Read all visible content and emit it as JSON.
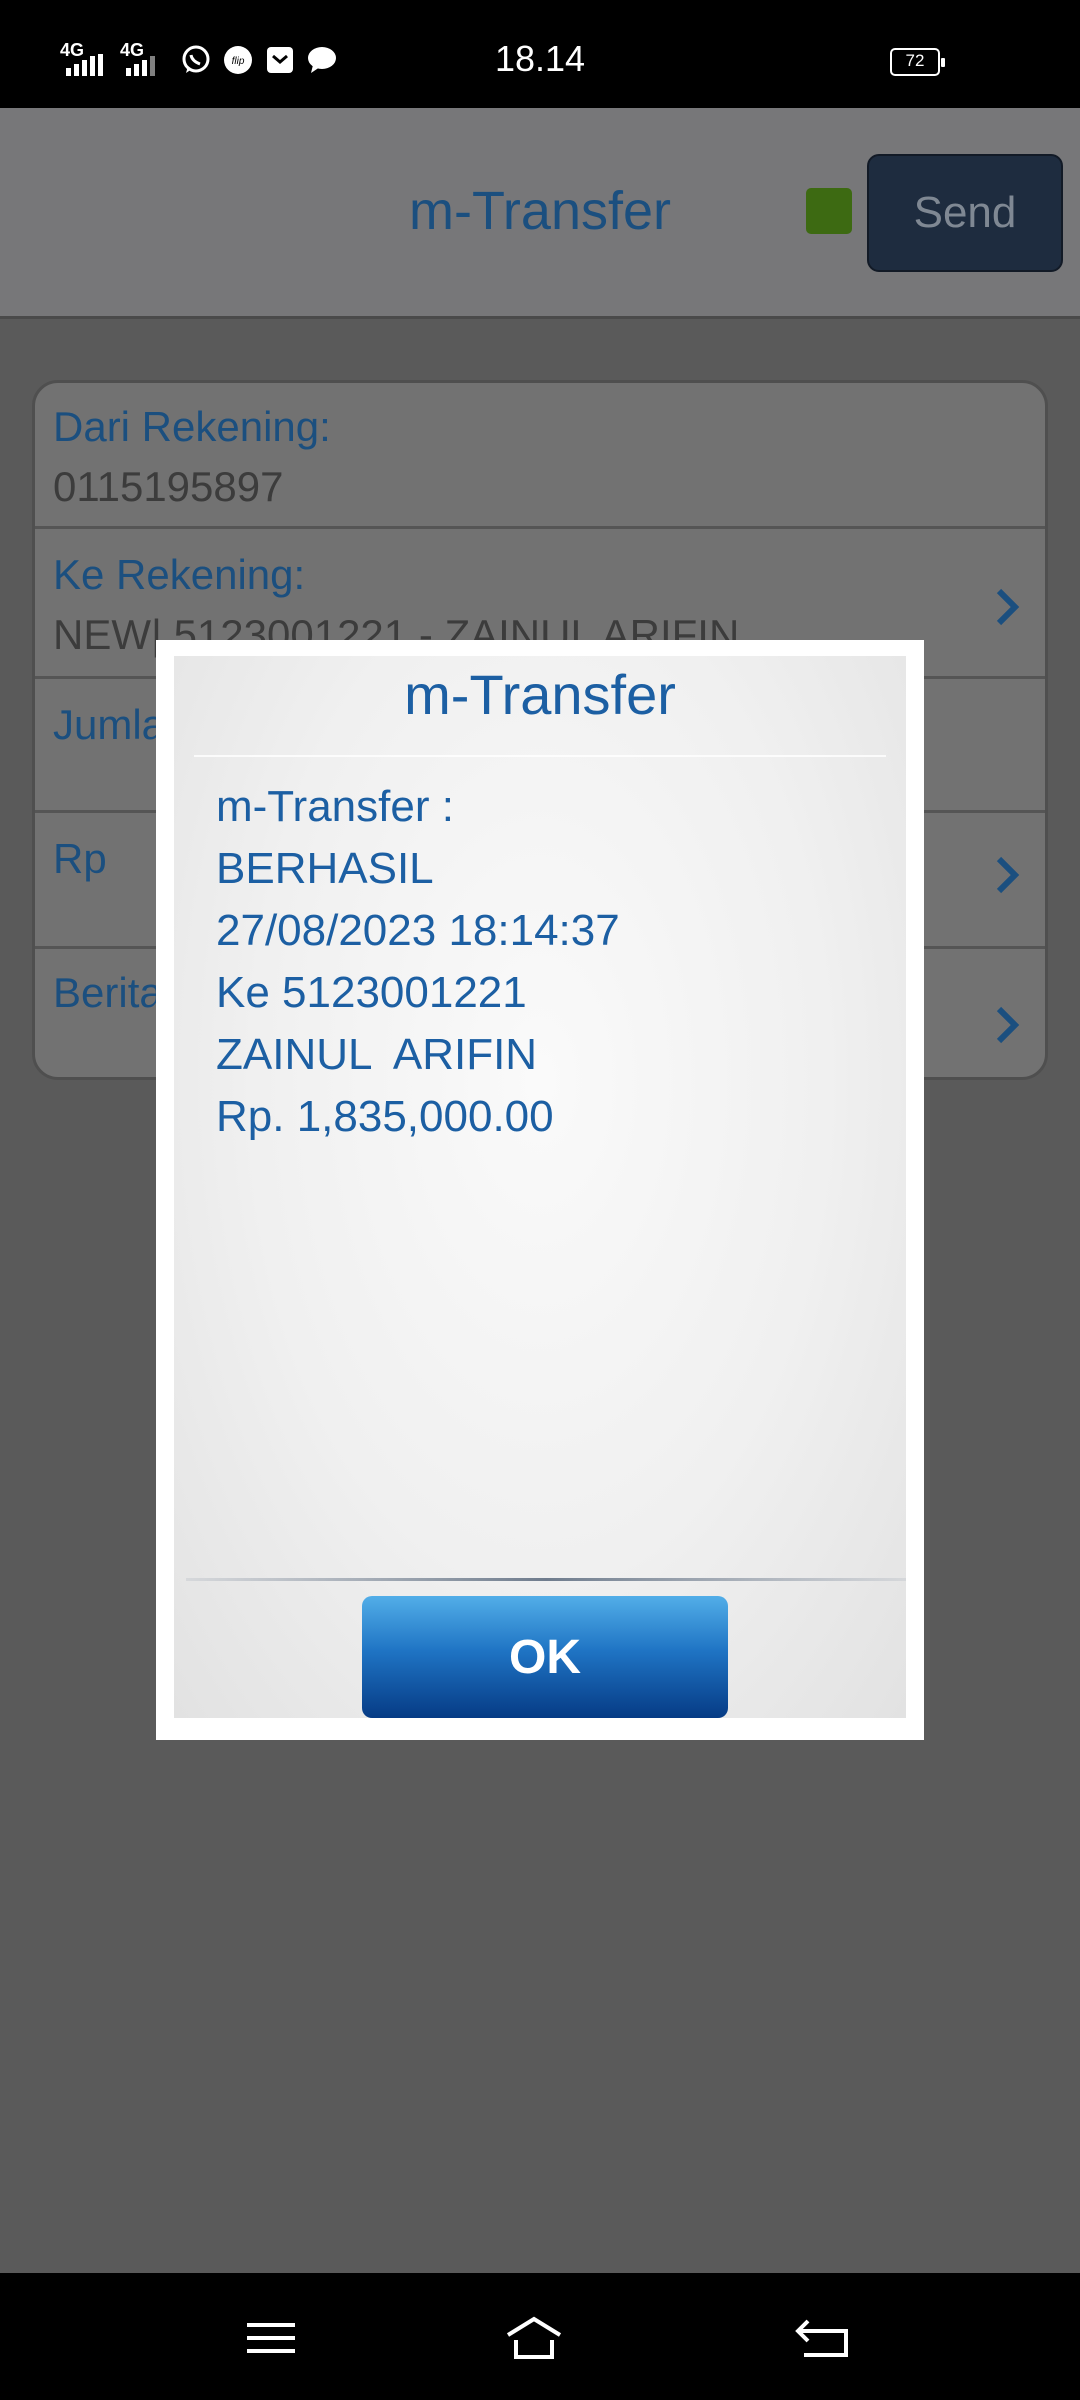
{
  "status_bar": {
    "signal1_label": "4G",
    "signal2_label": "4G",
    "time": "18.14",
    "battery": "72",
    "app_icons": [
      "whatsapp-icon",
      "flip-icon",
      "mail-icon",
      "chat-icon"
    ],
    "flip_label": "flip"
  },
  "header": {
    "title": "m-Transfer",
    "send_label": "Send",
    "status_led_color": "#3d6a12"
  },
  "form": {
    "from_label": "Dari Rekening:",
    "from_value": "0115195897",
    "to_label": "Ke Rekening:",
    "to_value": "NEW| 5123001221 - ZAINUL  ARIFIN",
    "amount_label": "Jumlah",
    "rp_label": "Rp",
    "note_label": "Berita"
  },
  "dialog": {
    "title": "m-Transfer",
    "lines": [
      "m-Transfer :",
      "BERHASIL",
      "27/08/2023 18:14:37",
      "Ke 5123001221",
      "ZAINUL  ARIFIN",
      "Rp. 1,835,000.00"
    ],
    "ok_label": "OK"
  },
  "colors": {
    "accent": "#1c5fa3",
    "ok_button_top": "#52aee8",
    "ok_button_bottom": "#063b85"
  },
  "nav": {
    "icons": [
      "menu-icon",
      "home-icon",
      "back-icon"
    ]
  }
}
